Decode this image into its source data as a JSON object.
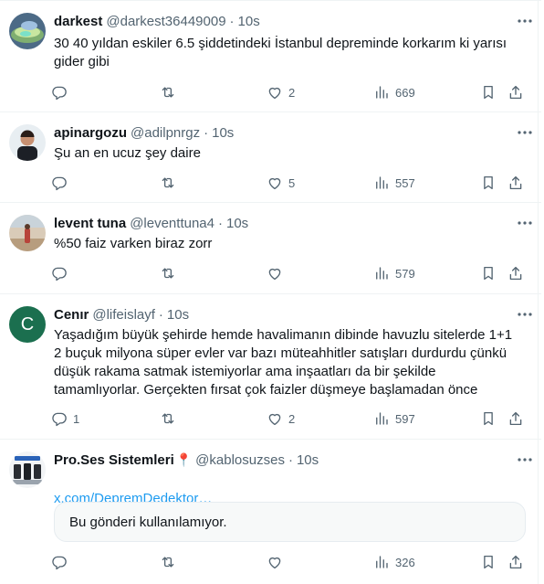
{
  "colors": {
    "text": "#0f1419",
    "muted": "#536471",
    "link": "#1d9bf0",
    "divider": "#eff3f4"
  },
  "icons": [
    "more-icon",
    "reply-icon",
    "retweet-icon",
    "like-icon",
    "views-icon",
    "bookmark-icon",
    "share-icon"
  ],
  "tweets": [
    {
      "name": "darkest",
      "handle": "@darkest36449009",
      "sep": "·",
      "time": "10s",
      "text": "30 40 yıldan eskiler 6.5 şiddetindeki İstanbul depreminde korkarım ki yarısı\ngider gibi",
      "replies": "",
      "retweets": "",
      "likes": "2",
      "views": "669"
    },
    {
      "name": "apinargozu",
      "handle": "@adilpnrgz",
      "sep": "·",
      "time": "10s",
      "text": "Şu an en ucuz şey daire",
      "replies": "",
      "retweets": "",
      "likes": "5",
      "views": "557"
    },
    {
      "name": "levent tuna",
      "handle": "@leventtuna4",
      "sep": "·",
      "time": "10s",
      "text": "%50 faiz varken biraz zorr",
      "replies": "",
      "retweets": "",
      "likes": "",
      "views": "579"
    },
    {
      "name": "Cenır",
      "handle": "@lifeislayf",
      "sep": "·",
      "time": "10s",
      "avatar_letter": "C",
      "text": "Yaşadığım büyük şehirde hemde havalimanın dibinde havuzlu sitelerde 1+1\n2 buçuk milyona süper evler var bazı müteahhitler satışları durdurdu çünkü\ndüşük rakama satmak istemiyorlar ama inşaatları da bir şekilde\ntamamlıyorlar. Gerçekten fırsat çok faizler düşmeye başlamadan önce",
      "replies": "1",
      "retweets": "",
      "likes": "2",
      "views": "597"
    },
    {
      "name": "Pro.Ses Sistemleri",
      "name_emoji": "📍",
      "handle": "@kablosuzses",
      "sep": "·",
      "time": "10s",
      "link": "x.com/DepremDedektor…",
      "unavailable": "Bu gönderi kullanılamıyor.",
      "replies": "",
      "retweets": "",
      "likes": "",
      "views": "326"
    }
  ]
}
